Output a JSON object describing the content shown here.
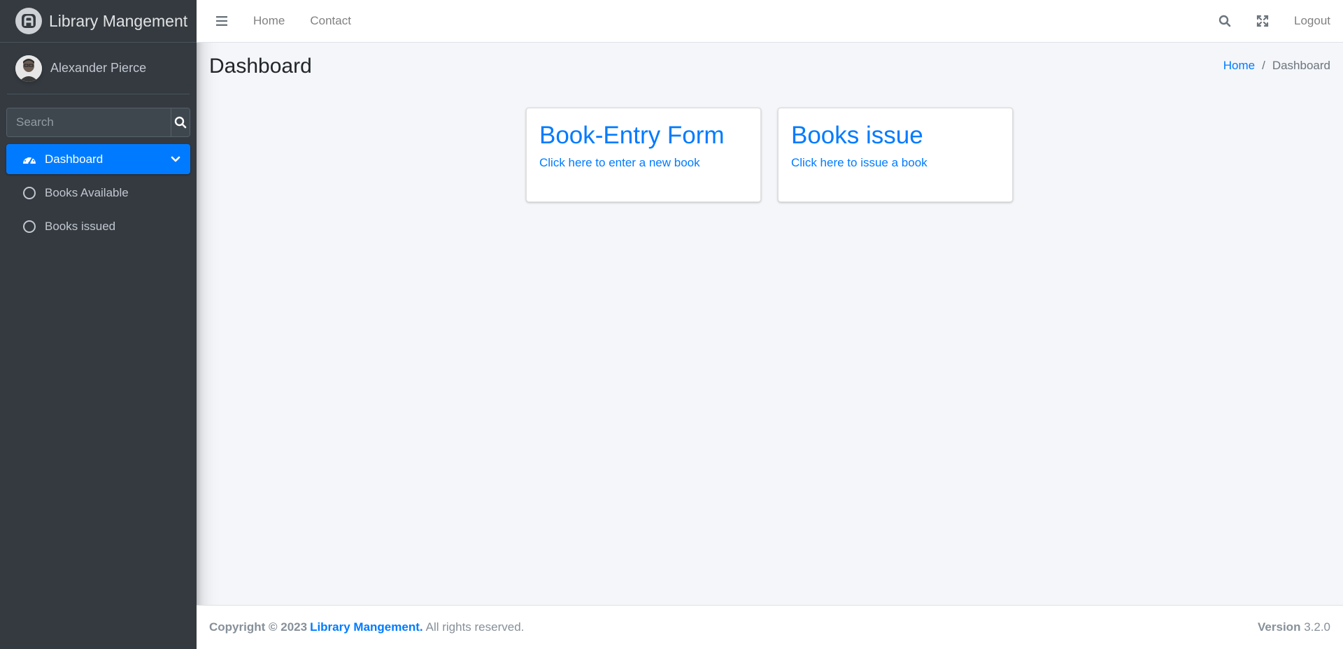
{
  "brand": {
    "name": "Library Mangement"
  },
  "user": {
    "name": "Alexander Pierce"
  },
  "search": {
    "placeholder": "Search"
  },
  "nav": {
    "dashboard": "Dashboard",
    "items": [
      {
        "label": "Books Available"
      },
      {
        "label": "Books issued"
      }
    ]
  },
  "topbar": {
    "home": "Home",
    "contact": "Contact",
    "logout": "Logout"
  },
  "page": {
    "title": "Dashboard"
  },
  "breadcrumb": {
    "home": "Home",
    "separator": "/",
    "current": "Dashboard"
  },
  "cards": [
    {
      "title": "Book-Entry Form",
      "text": "Click here to enter a new book"
    },
    {
      "title": "Books issue",
      "text": "Click here to issue a book"
    }
  ],
  "footer": {
    "copyright": "Copyright © 2023",
    "brand": "Library Mangement.",
    "rights": "All rights reserved.",
    "version_label": "Version",
    "version": "3.2.0"
  },
  "colors": {
    "accent": "#007bff",
    "sidebar": "#343a40",
    "background": "#f4f6f9"
  },
  "icons": [
    "brand-logo-icon",
    "search-icon",
    "dashboard-gauge-icon",
    "chevron-down-icon",
    "circle-icon",
    "hamburger-icon",
    "expand-icon"
  ]
}
